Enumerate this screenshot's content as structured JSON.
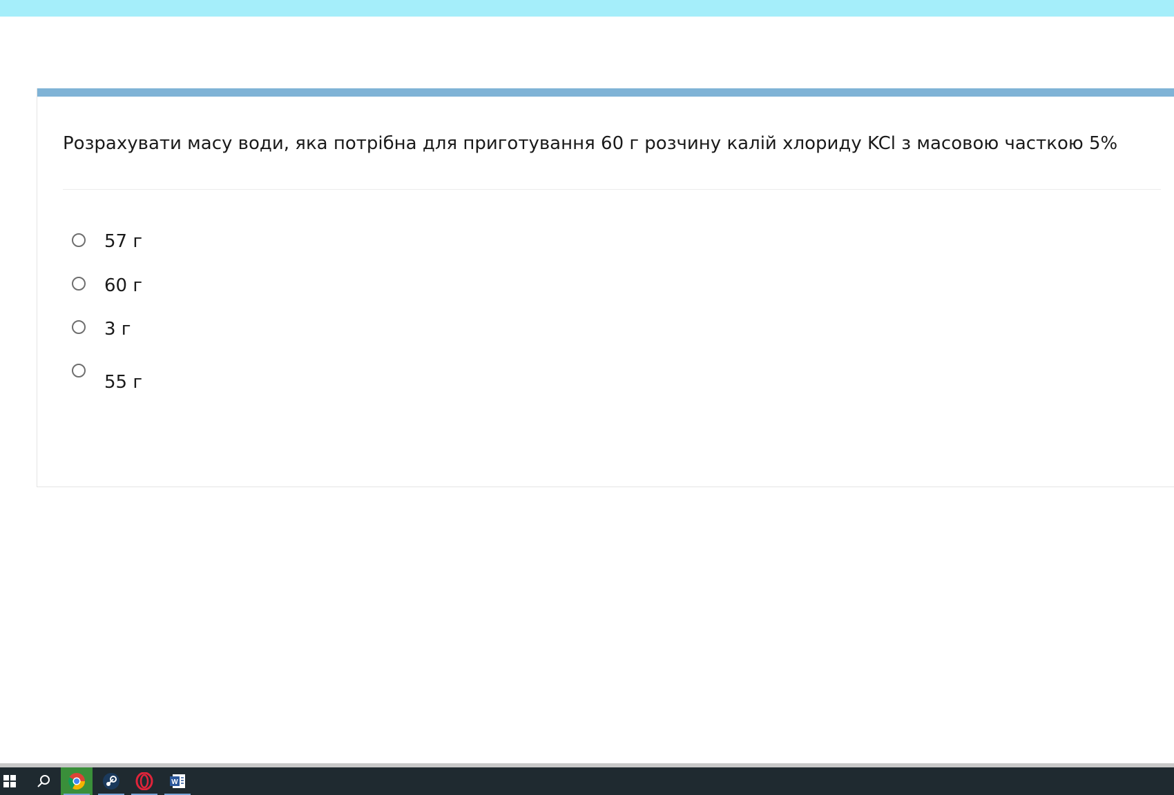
{
  "quiz": {
    "question": "Розрахувати масу води, яка потрібна для приготування 60 г розчину калій хлориду KCl з масовою часткою 5%",
    "options": [
      {
        "label": "57 г",
        "selected": false
      },
      {
        "label": "60 г",
        "selected": false
      },
      {
        "label": "3 г",
        "selected": false
      },
      {
        "label": "55 г",
        "selected": false
      }
    ]
  },
  "taskbar": {
    "items": [
      {
        "icon": "windows-start-icon"
      },
      {
        "icon": "search-icon"
      },
      {
        "icon": "chrome-icon",
        "active": true
      },
      {
        "icon": "steam-icon"
      },
      {
        "icon": "opera-icon"
      },
      {
        "icon": "word-icon"
      }
    ]
  },
  "colors": {
    "top_bar": "#a5eefa",
    "card_accent": "#7fb3d6",
    "taskbar": "#1f2a30"
  }
}
